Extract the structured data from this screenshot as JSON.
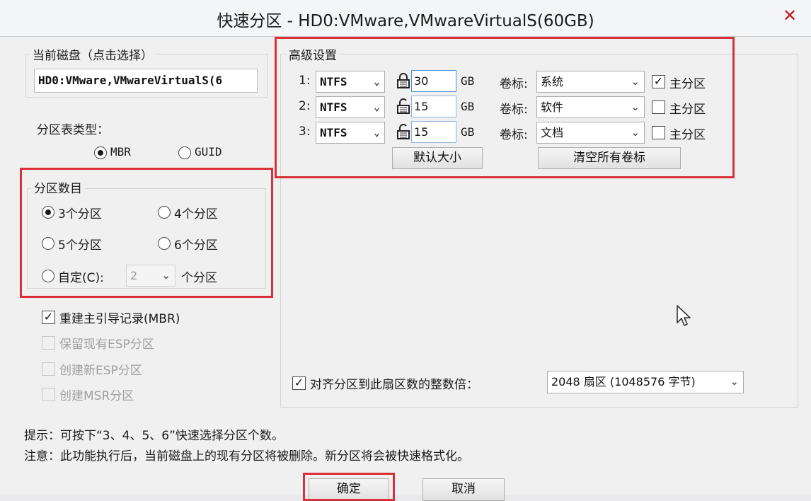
{
  "window": {
    "title": "快速分区 - HD0:VMware,VMwareVirtualS(60GB)",
    "close_glyph": "✕"
  },
  "current_disk": {
    "label": "当前磁盘（点击选择）",
    "value": "HD0:VMware,VMwareVirtualS(6"
  },
  "partition_table": {
    "label": "分区表类型：",
    "options": [
      "MBR",
      "GUID"
    ],
    "selected": "MBR"
  },
  "partition_count": {
    "label": "分区数目",
    "options": [
      "3个分区",
      "4个分区",
      "5个分区",
      "6个分区"
    ],
    "selected": "3个分区",
    "custom_label": "自定(C):",
    "custom_value": "2",
    "custom_suffix": "个分区"
  },
  "options": {
    "rebuild_mbr": "重建主引导记录(MBR)",
    "keep_esp": "保留现有ESP分区",
    "create_esp": "创建新ESP分区",
    "create_msr": "创建MSR分区"
  },
  "advanced": {
    "label": "高级设置",
    "rows": [
      {
        "index": "1:",
        "fs": "NTFS",
        "size": "30",
        "unit": "GB",
        "vol_label": "卷标:",
        "vol": "系统",
        "primary": "主分区",
        "primary_checked": true,
        "locked": true
      },
      {
        "index": "2:",
        "fs": "NTFS",
        "size": "15",
        "unit": "GB",
        "vol_label": "卷标:",
        "vol": "软件",
        "primary": "主分区",
        "primary_checked": false,
        "locked": false
      },
      {
        "index": "3:",
        "fs": "NTFS",
        "size": "15",
        "unit": "GB",
        "vol_label": "卷标:",
        "vol": "文档",
        "primary": "主分区",
        "primary_checked": false,
        "locked": false
      }
    ],
    "default_size_button": "默认大小",
    "clear_labels_button": "清空所有卷标"
  },
  "align": {
    "label": "对齐分区到此扇区数的整数倍：",
    "value": "2048 扇区 (1048576 字节)"
  },
  "notes": {
    "hint": "提示：可按下“3、4、5、6”快速选择分区个数。",
    "warning": "注意：此功能执行后，当前磁盘上的现有分区将被删除。新分区将会被快速格式化。"
  },
  "buttons": {
    "ok": "确定",
    "cancel": "取消"
  },
  "colors": {
    "highlight": "#d9313a",
    "background": "#f0f0f0"
  }
}
